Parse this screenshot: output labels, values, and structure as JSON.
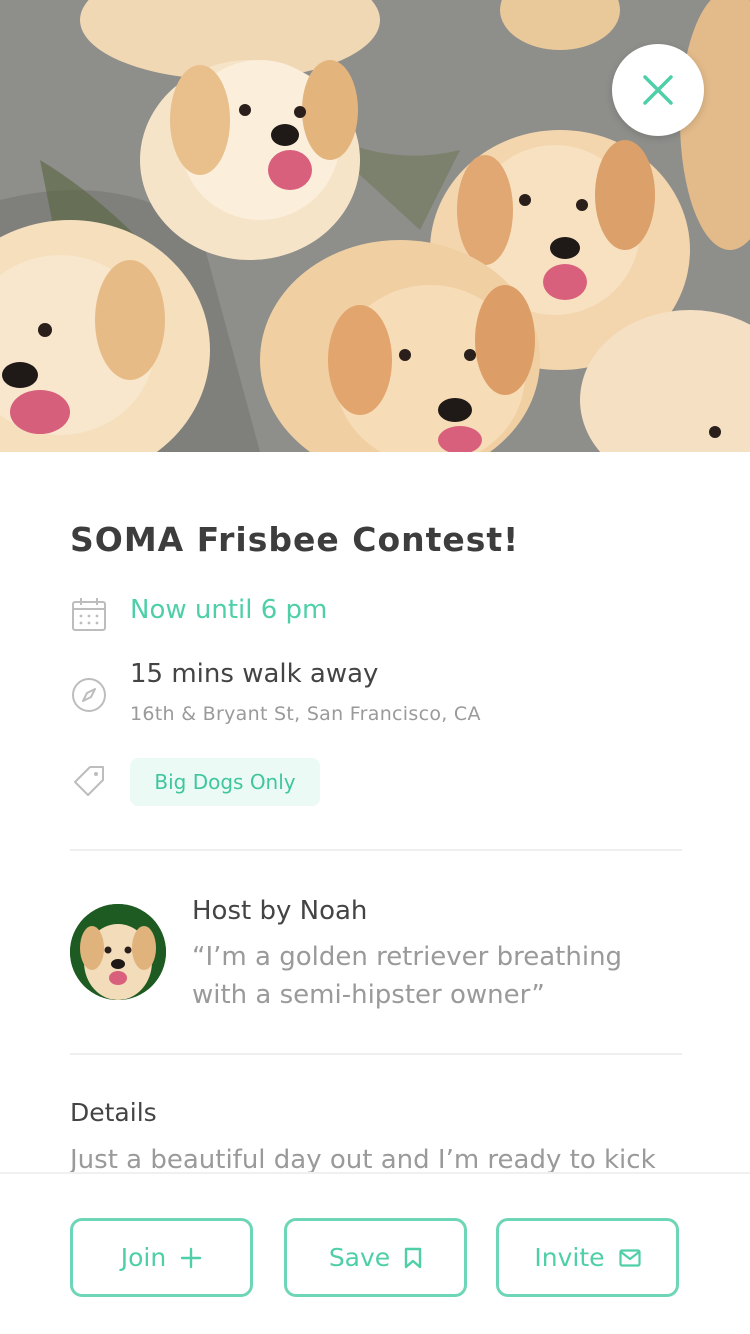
{
  "hero": {
    "image_icon": "puppies-photo",
    "close_icon": "close-icon"
  },
  "event": {
    "title": "SOMA Frisbee Contest!",
    "time": "Now until 6 pm",
    "walk": "15 mins walk away",
    "address": "16th & Bryant St, San Francisco, CA",
    "tag": "Big Dogs Only"
  },
  "host": {
    "name": "Host by Noah",
    "quote": "“I’m a golden retriever breathing with a semi-hipster owner”"
  },
  "details": {
    "label": "Details",
    "text": "Just a beautiful day out and I’m ready to kick"
  },
  "actions": {
    "join": "Join",
    "save": "Save",
    "invite": "Invite"
  },
  "colors": {
    "accent": "#4fcfa8",
    "tag_bg": "#ecfaf5",
    "muted_text": "#9a9a9a",
    "divider": "#efefef"
  }
}
